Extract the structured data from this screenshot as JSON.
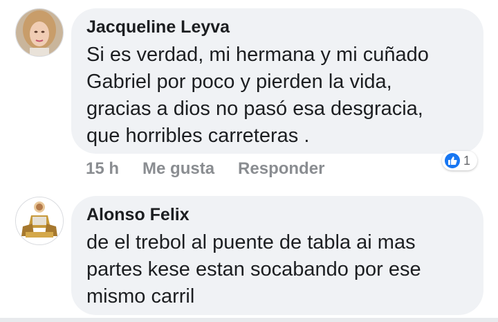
{
  "comments": [
    {
      "author": "Jacqueline Leyva",
      "text": "Si es verdad, mi hermana y mi cuñado\nGabriel por poco y pierden la vida,\ngracias a dios no pasó esa desgracia,\nque horribles carreteras .",
      "time": "15 h",
      "like_label": "Me gusta",
      "reply_label": "Responder",
      "reaction": {
        "icon": "like-icon",
        "count": "1"
      }
    },
    {
      "author": "Alonso Felix",
      "text": "de el trebol al puente de tabla ai mas\npartes kese estan socabando por ese\nmismo carril"
    }
  ],
  "colors": {
    "like_blue": "#1877f2",
    "bubble_bg": "#f0f2f5",
    "meta_gray": "#8a8d91"
  }
}
